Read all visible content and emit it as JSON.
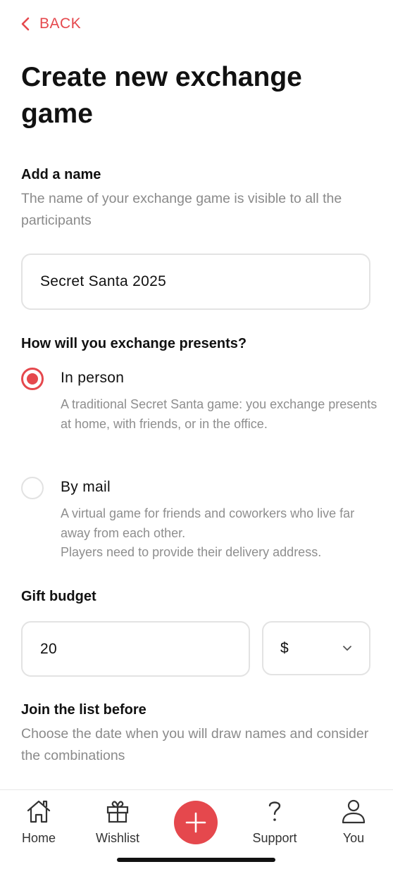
{
  "nav": {
    "back_label": "BACK"
  },
  "page": {
    "title": "Create new exchange game"
  },
  "name_section": {
    "title": "Add a name",
    "description": "The name of your exchange game is visible to all the participants",
    "input_value": "Secret Santa 2025"
  },
  "exchange_section": {
    "title": "How will you exchange presents?",
    "options": [
      {
        "label": "In person",
        "description": "A traditional Secret Santa game: you exchange presents at home, with friends, or in the office.",
        "selected": true
      },
      {
        "label": "By mail",
        "description_line1": "A virtual game for friends and coworkers who live far away from each other.",
        "description_line2": "Players need to provide their delivery address.",
        "selected": false
      }
    ]
  },
  "budget_section": {
    "title": "Gift budget",
    "amount_value": "20",
    "currency_value": "$"
  },
  "join_section": {
    "title": "Join the list before",
    "description": "Choose the date when you will draw names and consider the combinations"
  },
  "tabbar": {
    "items": [
      {
        "label": "Home",
        "icon": "home-icon"
      },
      {
        "label": "Wishlist",
        "icon": "gift-icon"
      },
      {
        "label": "",
        "icon": "plus-icon"
      },
      {
        "label": "Support",
        "icon": "question-icon"
      },
      {
        "label": "You",
        "icon": "user-icon"
      }
    ]
  },
  "colors": {
    "accent": "#e5484d",
    "muted_text": "#8a8a8a",
    "border": "#e3e3e3"
  }
}
